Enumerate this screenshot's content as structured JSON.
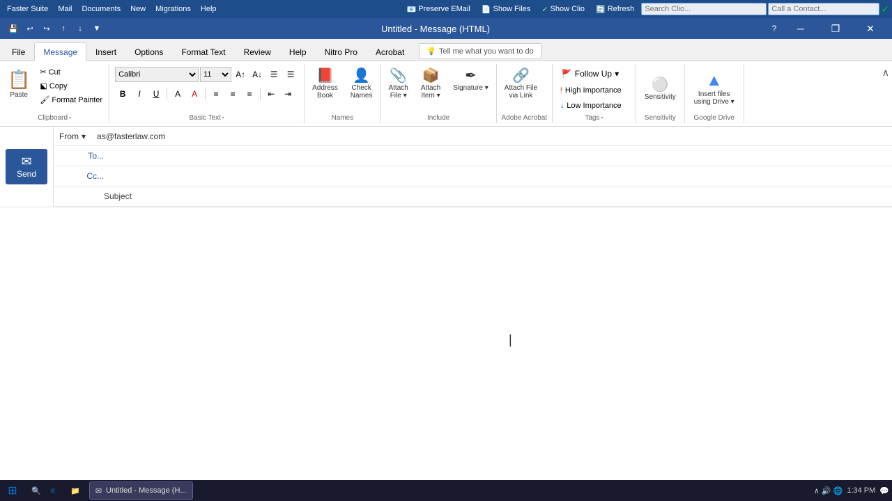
{
  "topbar": {
    "suite_label": "Faster Suite",
    "mail_label": "Mail",
    "documents_label": "Documents",
    "new_label": "New",
    "migrations_label": "Migrations",
    "help_label": "Help",
    "preserve_email_label": "Preserve EMail",
    "show_files_label": "Show Files",
    "show_clio_label": "Show Clio",
    "refresh_label": "Refresh",
    "search_placeholder": "Search Clio...",
    "contact_placeholder": "Call a Contact...",
    "green_check": "✓"
  },
  "titlebar": {
    "title": "Untitled - Message (HTML)",
    "min": "─",
    "restore": "❐",
    "close": "✕"
  },
  "quickaccess": {
    "save": "💾",
    "undo": "↩",
    "redo": "↪",
    "up": "↑",
    "down": "↓",
    "customize": "▼"
  },
  "tabs": {
    "file": "File",
    "message": "Message",
    "insert": "Insert",
    "options": "Options",
    "format_text": "Format Text",
    "review": "Review",
    "help": "Help",
    "nitro_pro": "Nitro Pro",
    "acrobat": "Acrobat",
    "tell_me": "Tell me what you want to do"
  },
  "ribbon": {
    "clipboard": {
      "paste": "📋",
      "paste_label": "Paste",
      "cut": "✂",
      "cut_label": "Cut",
      "copy": "⬕",
      "copy_label": "Copy",
      "format_painter": "🖌",
      "format_painter_label": "Format Painter",
      "group_label": "Clipboard",
      "expand_icon": "⬞"
    },
    "basic_text": {
      "font": "Calibri",
      "font_size": "11",
      "grow": "A↑",
      "shrink": "A↓",
      "bullets": "☰",
      "numbering": "☰",
      "bold": "B",
      "italic": "I",
      "underline": "U",
      "more_format": "A",
      "group_label": "Basic Text",
      "expand_icon": "⬞",
      "align_left": "≡",
      "align_center": "≡",
      "align_right": "≡",
      "indent_dec": "⇤",
      "indent_inc": "⇥"
    },
    "names": {
      "address_book_icon": "📕",
      "address_book_label": "Address\nBook",
      "check_names_icon": "👤",
      "check_names_label": "Check\nNames",
      "group_label": "Names"
    },
    "include": {
      "attach_file_icon": "📎",
      "attach_file_label": "Attach\nFile",
      "attach_item_icon": "📎",
      "attach_item_label": "Attach\nItem",
      "signature_icon": "✒",
      "signature_label": "Signature",
      "group_label": "Include"
    },
    "adobe_acrobat": {
      "attach_link_icon": "🔗",
      "attach_link_label": "Attach File\nvia Link",
      "group_label": "Adobe Acrobat"
    },
    "tags": {
      "follow_up_icon": "🚩",
      "follow_up_label": "Follow Up",
      "high_importance_icon": "!",
      "high_importance_label": "High Importance",
      "low_importance_icon": "↓",
      "low_importance_label": "Low Importance",
      "group_label": "Tags",
      "expand_icon": "⬞"
    },
    "sensitivity": {
      "icon": "⚪",
      "label": "Sensitivity",
      "group_label": "Sensitivity"
    },
    "google_drive": {
      "icon": "▲",
      "label": "Insert files\nusing Drive",
      "group_label": "Google Drive"
    }
  },
  "compose": {
    "send_label": "Send",
    "from_label": "From",
    "from_email": "as@fasterlaw.com",
    "from_dropdown": "▾",
    "to_label": "To...",
    "cc_label": "Cc...",
    "subject_label": "Subject",
    "to_value": "",
    "cc_value": "",
    "subject_value": ""
  },
  "taskbar": {
    "start_icon": "⊞",
    "edge_icon": "e",
    "explorer_icon": "📁",
    "untitled_label": "Untitled - Message (H...",
    "time": "1:34 PM",
    "system_icons": "∧  🔊  🌐",
    "notification_icon": "💬"
  }
}
